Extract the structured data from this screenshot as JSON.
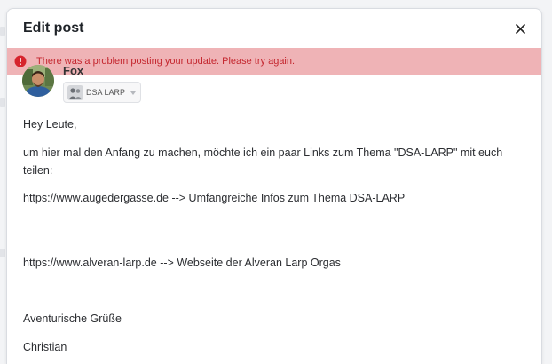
{
  "modal": {
    "title": "Edit post"
  },
  "error": {
    "message": "There was a problem posting your update. Please try again."
  },
  "author": {
    "name": "Fox"
  },
  "group": {
    "name": "DSA LARP"
  },
  "post": {
    "greeting": "Hey Leute,",
    "intro": "um hier mal den Anfang zu machen, möchte ich ein paar Links zum Thema \"DSA-LARP\" mit euch teilen:",
    "link1": "https://www.augedergasse.de --> Umfangreiche Infos zum Thema DSA-LARP",
    "link2": "https://www.alveran-larp.de --> Webseite der Alveran Larp Orgas",
    "closing": "Aventurische Grüße",
    "signature": "Christian"
  },
  "colors": {
    "error_bg": "#efb3b6",
    "error_text": "#c4262e",
    "title_text": "#1f2328"
  },
  "icons": {
    "close": "close-icon",
    "error": "error-circle-icon",
    "group": "group-avatar-icon",
    "caret": "chevron-down-icon"
  }
}
